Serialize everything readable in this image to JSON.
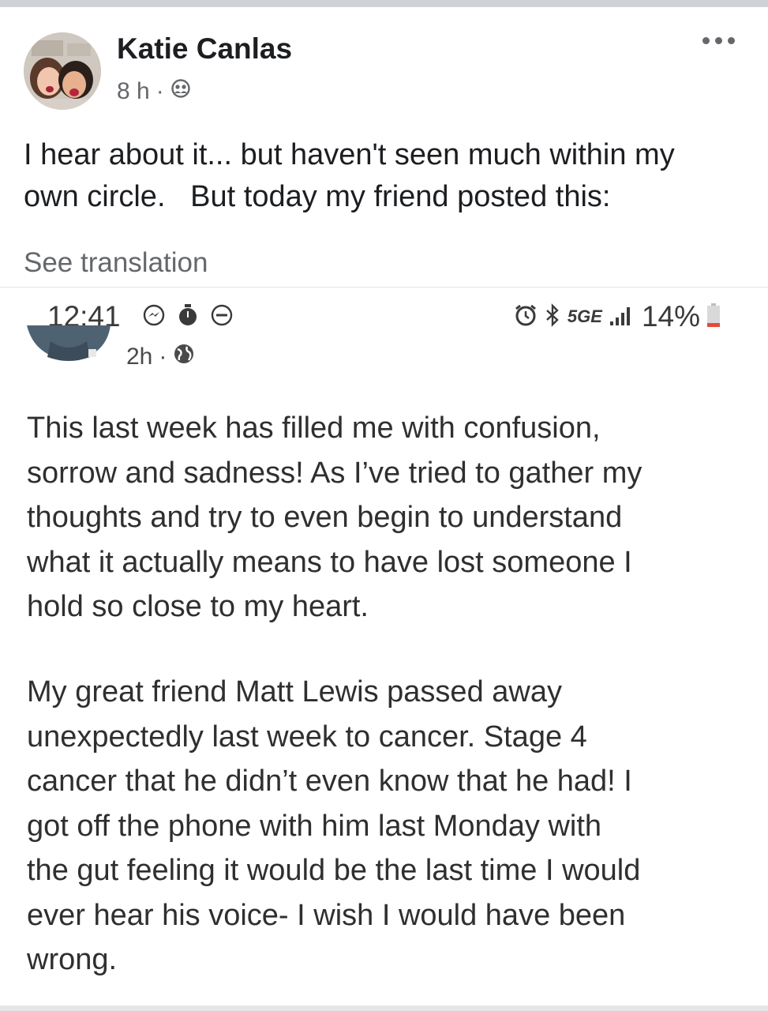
{
  "post": {
    "author_name": "Katie Canlas",
    "time": "8 h",
    "separator": "·",
    "audience_icon": "friends-icon",
    "text_line_1": "I hear about it... but haven't seen much within my",
    "text_line_2": "own circle.   But today my friend posted this:",
    "see_translation": "See translation",
    "more_icon": "more-horizontal-icon"
  },
  "shared_screenshot": {
    "status_bar": {
      "time": "12:41",
      "left_icons": [
        "messenger-icon",
        "stopwatch-icon",
        "do-not-disturb-icon"
      ],
      "right_icons": [
        "alarm-icon",
        "bluetooth-icon",
        "signal-bars-icon",
        "battery-icon"
      ],
      "network": "5GE",
      "battery_percent": "14%"
    },
    "inner_post": {
      "time": "2h",
      "separator": "·",
      "audience_icon": "globe-icon",
      "paragraph_1": [
        "This last week has filled me with confusion,",
        "sorrow and sadness! As I’ve tried to gather my",
        "thoughts and try to even begin to understand",
        "what it actually means to have lost someone I",
        "hold so close to my heart."
      ],
      "paragraph_2": [
        "My great friend Matt Lewis passed away",
        "unexpectedly last week to cancer. Stage 4",
        "cancer that he didn’t even know that he had! I",
        "got off the phone with him last Monday with",
        "the gut feeling it would be the last time I would",
        "ever hear his voice- I wish I would have been",
        "wrong."
      ]
    }
  },
  "colors": {
    "primary_text": "#1c1e21",
    "secondary_text": "#65676b",
    "screenshot_text": "#2f2f2f",
    "battery_low": "#e64a3b"
  }
}
